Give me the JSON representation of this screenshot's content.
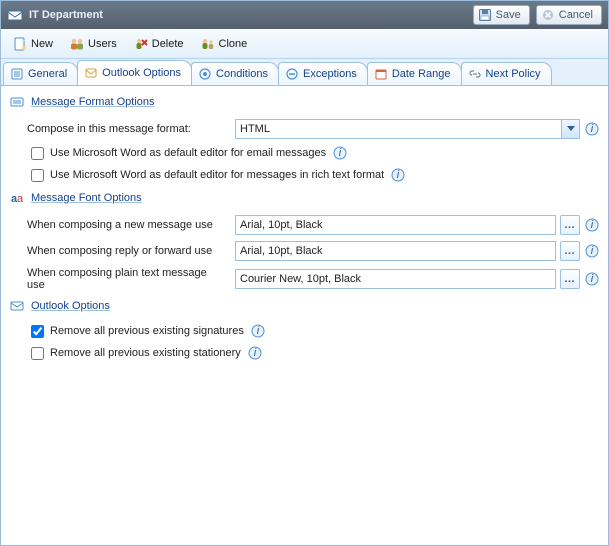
{
  "window": {
    "title": "IT Department"
  },
  "header_buttons": {
    "save": "Save",
    "cancel": "Cancel"
  },
  "toolbar": {
    "new": "New",
    "users": "Users",
    "delete": "Delete",
    "clone": "Clone"
  },
  "tabs": {
    "general": "General",
    "outlook_options": "Outlook Options",
    "conditions": "Conditions",
    "exceptions": "Exceptions",
    "date_range": "Date Range",
    "next_policy": "Next Policy"
  },
  "sections": {
    "msg_format": "Message Format Options",
    "msg_font": "Message Font Options",
    "outlook_opts": "Outlook Options"
  },
  "msg_format": {
    "compose_label": "Compose in this message format:",
    "compose_value": "HTML",
    "word_email": "Use Microsoft Word as default editor for email messages",
    "word_rtf": "Use Microsoft Word as default editor for messages in rich text format"
  },
  "msg_font": {
    "new_label": "When composing a new message use",
    "new_value": "Arial, 10pt,  Black",
    "reply_label": "When composing reply or forward use",
    "reply_value": "Arial, 10pt,  Black",
    "plain_label": "When composing plain text message use",
    "plain_value": "Courier New, 10pt,  Black"
  },
  "outlook_opts": {
    "remove_sig": "Remove all previous existing signatures",
    "remove_stat": "Remove all previous existing stationery"
  }
}
